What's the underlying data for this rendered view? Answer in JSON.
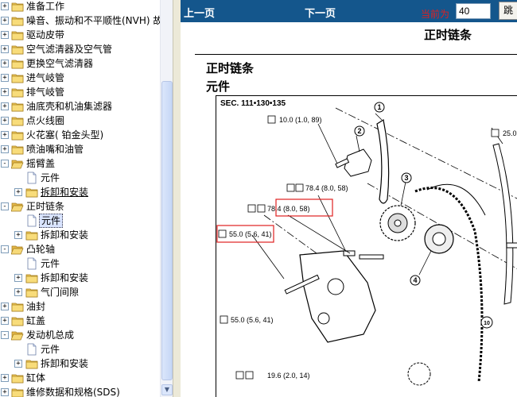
{
  "tree": {
    "items": [
      {
        "label": "准备工作",
        "indent": 0,
        "expander": "+",
        "icon": "folder"
      },
      {
        "label": "噪音、振动和不平顺性(NVH) 故",
        "indent": 0,
        "expander": "+",
        "icon": "folder"
      },
      {
        "label": "驱动皮带",
        "indent": 0,
        "expander": "+",
        "icon": "folder"
      },
      {
        "label": "空气滤清器及空气管",
        "indent": 0,
        "expander": "+",
        "icon": "folder"
      },
      {
        "label": "更换空气滤清器",
        "indent": 0,
        "expander": "+",
        "icon": "folder"
      },
      {
        "label": "进气岐管",
        "indent": 0,
        "expander": "+",
        "icon": "folder"
      },
      {
        "label": "排气岐管",
        "indent": 0,
        "expander": "+",
        "icon": "folder"
      },
      {
        "label": "油底壳和机油集滤器",
        "indent": 0,
        "expander": "+",
        "icon": "folder"
      },
      {
        "label": "点火线圈",
        "indent": 0,
        "expander": "+",
        "icon": "folder"
      },
      {
        "label": "火花塞( 铂金头型)",
        "indent": 0,
        "expander": "+",
        "icon": "folder"
      },
      {
        "label": "喷油嘴和油管",
        "indent": 0,
        "expander": "+",
        "icon": "folder"
      },
      {
        "label": "摇臂盖",
        "indent": 0,
        "expander": "-",
        "icon": "folder-open"
      },
      {
        "label": "元件",
        "indent": 1,
        "expander": "",
        "icon": "page"
      },
      {
        "label": "拆卸和安装",
        "indent": 1,
        "expander": "+",
        "icon": "folder",
        "underline": true
      },
      {
        "label": "正时链条",
        "indent": 0,
        "expander": "-",
        "icon": "folder-open"
      },
      {
        "label": "元件",
        "indent": 1,
        "expander": "",
        "icon": "page",
        "selected": true
      },
      {
        "label": "拆卸和安装",
        "indent": 1,
        "expander": "+",
        "icon": "folder"
      },
      {
        "label": "凸轮轴",
        "indent": 0,
        "expander": "-",
        "icon": "folder-open"
      },
      {
        "label": "元件",
        "indent": 1,
        "expander": "",
        "icon": "page"
      },
      {
        "label": "拆卸和安装",
        "indent": 1,
        "expander": "+",
        "icon": "folder"
      },
      {
        "label": "气门间隙",
        "indent": 1,
        "expander": "+",
        "icon": "folder"
      },
      {
        "label": "油封",
        "indent": 0,
        "expander": "+",
        "icon": "folder"
      },
      {
        "label": "缸盖",
        "indent": 0,
        "expander": "+",
        "icon": "folder"
      },
      {
        "label": "发动机总成",
        "indent": 0,
        "expander": "-",
        "icon": "folder-open"
      },
      {
        "label": "元件",
        "indent": 1,
        "expander": "",
        "icon": "page"
      },
      {
        "label": "拆卸和安装",
        "indent": 1,
        "expander": "+",
        "icon": "folder"
      },
      {
        "label": "缸体",
        "indent": 0,
        "expander": "+",
        "icon": "folder"
      },
      {
        "label": "维修数据和规格(SDS)",
        "indent": 0,
        "expander": "+",
        "icon": "folder"
      }
    ]
  },
  "nav": {
    "prev_label": "上一页",
    "next_label": "下一页",
    "current_label": "当前为",
    "page_value": "40",
    "jump_label": "跳"
  },
  "doc": {
    "page_title": "正时链条",
    "section_title": "正时链条",
    "sub_title": "元件",
    "figure": {
      "sec_label": "SEC. 111•130•135",
      "torques": [
        "10.0 (1.0, 89)",
        "78.4 (8.0, 58)",
        "78.4 (8.0, 58)",
        "55.0 (5.6, 41)",
        "55.0 (5.6, 41)",
        "19.6 (2.0, 14)",
        "25.0 ("
      ],
      "callouts": [
        "1",
        "2",
        "3",
        "4",
        "10"
      ]
    }
  },
  "colors": {
    "nav_bg": "#14568c",
    "highlight_box": "#e02020",
    "selected_bg": "#d9e4ff",
    "folder": "#f2cb5a"
  }
}
